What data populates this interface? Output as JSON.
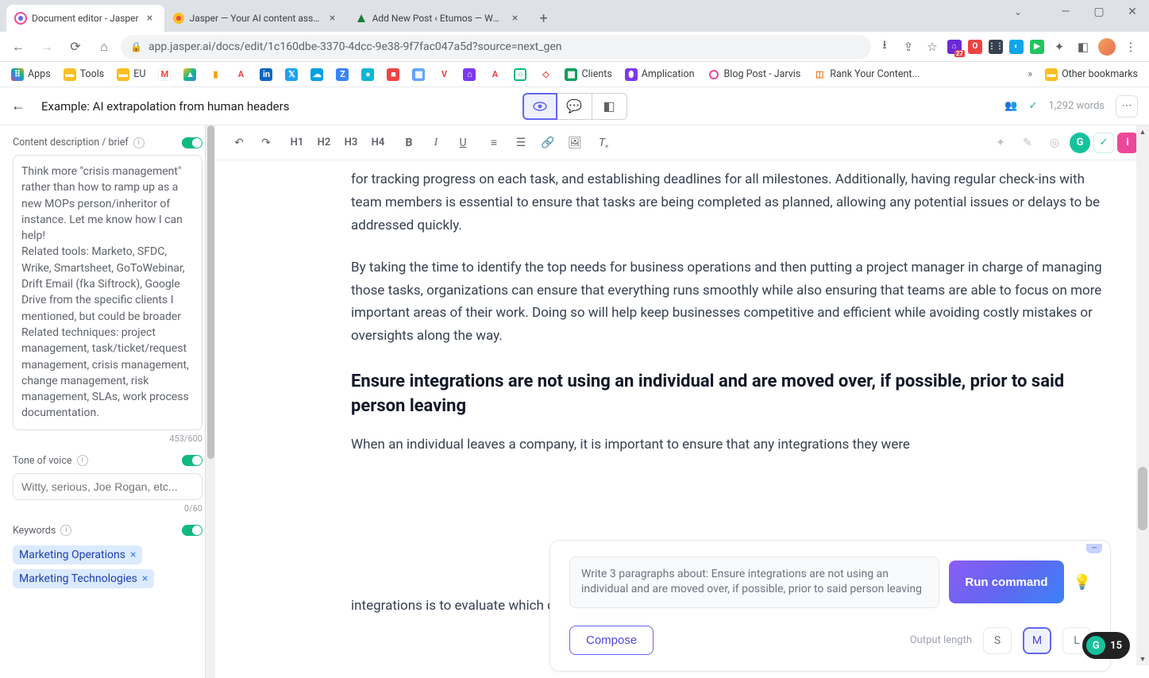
{
  "browser": {
    "tabs": [
      {
        "title": "Document editor - Jasper",
        "active": true
      },
      {
        "title": "Jasper — Your AI content assistan",
        "active": false
      },
      {
        "title": "Add New Post ‹ Etumos — Word",
        "active": false
      }
    ],
    "url": "app.jasper.ai/docs/edit/1c160dbe-3370-4dcc-9e38-9f7fac047a5d?source=next_gen",
    "window_controls": {
      "min": "—",
      "max": "▢",
      "close": "✕"
    }
  },
  "bookmarks": {
    "items": [
      "Apps",
      "Tools",
      "EU",
      "",
      "",
      "",
      "",
      "",
      "",
      "",
      "",
      "",
      "",
      "",
      "",
      "",
      "",
      "",
      "",
      "",
      "",
      "Clients",
      "Amplication",
      "Blog Post - Jarvis",
      "Rank Your Content..."
    ],
    "other": "Other bookmarks"
  },
  "header": {
    "doc_title": "Example: AI extrapolation from human headers",
    "word_count": "1,292 words"
  },
  "sidebar": {
    "brief_label": "Content description / brief",
    "brief_text": "Think more \"crisis management\" rather than how to ramp up as a new MOPs person/inheritor of instance. Let me know how I can help!\nRelated tools: Marketo, SFDC, Wrike, Smartsheet, GoToWebinar, Drift Email (fka Siftrock), Google Drive from the specific clients I mentioned, but could be broader\nRelated techniques: project management, task/ticket/request management, crisis management, change management, risk management, SLAs, work process documentation.",
    "brief_count": "453/600",
    "tone_label": "Tone of voice",
    "tone_placeholder": "Witty, serious, Joe Rogan, etc...",
    "tone_count": "0/60",
    "keywords_label": "Keywords",
    "keywords": [
      "Marketing Operations",
      "Marketing Technologies"
    ]
  },
  "toolbar": {
    "headings": [
      "H1",
      "H2",
      "H3",
      "H4"
    ],
    "bold": "B",
    "italic": "I",
    "underline": "U"
  },
  "document": {
    "p1": "for tracking progress on each task, and establishing deadlines for all milestones. Additionally, having regular check-ins with team members is essential to ensure that tasks are being completed as planned, allowing any potential issues or delays to be addressed quickly.",
    "p2": "By taking the time to identify the top needs for business operations and then putting a project manager in charge of managing those tasks, organizations can ensure that everything runs smoothly while also ensuring that teams are able to focus on more important areas of their work. Doing so will help keep businesses competitive and efficient while avoiding costly mistakes or oversights along the way.",
    "h2": "Ensure integrations are not using an individual and are moved over, if possible, prior to said person leaving",
    "p3": "When an individual leaves a company, it is important to ensure that any integrations they were",
    "p4": "integrations is to evaluate which ones need to be moved over. This involves looking at each"
  },
  "command": {
    "input_text": "Write 3 paragraphs about: Ensure integrations are not using an individual and are moved over, if possible, prior to said person leaving",
    "run_label": "Run command",
    "compose_label": "Compose",
    "output_length_label": "Output length",
    "lengths": [
      "S",
      "M",
      "L"
    ],
    "active_length": "M"
  },
  "grammarly_count": "15",
  "ext_badge": "27"
}
